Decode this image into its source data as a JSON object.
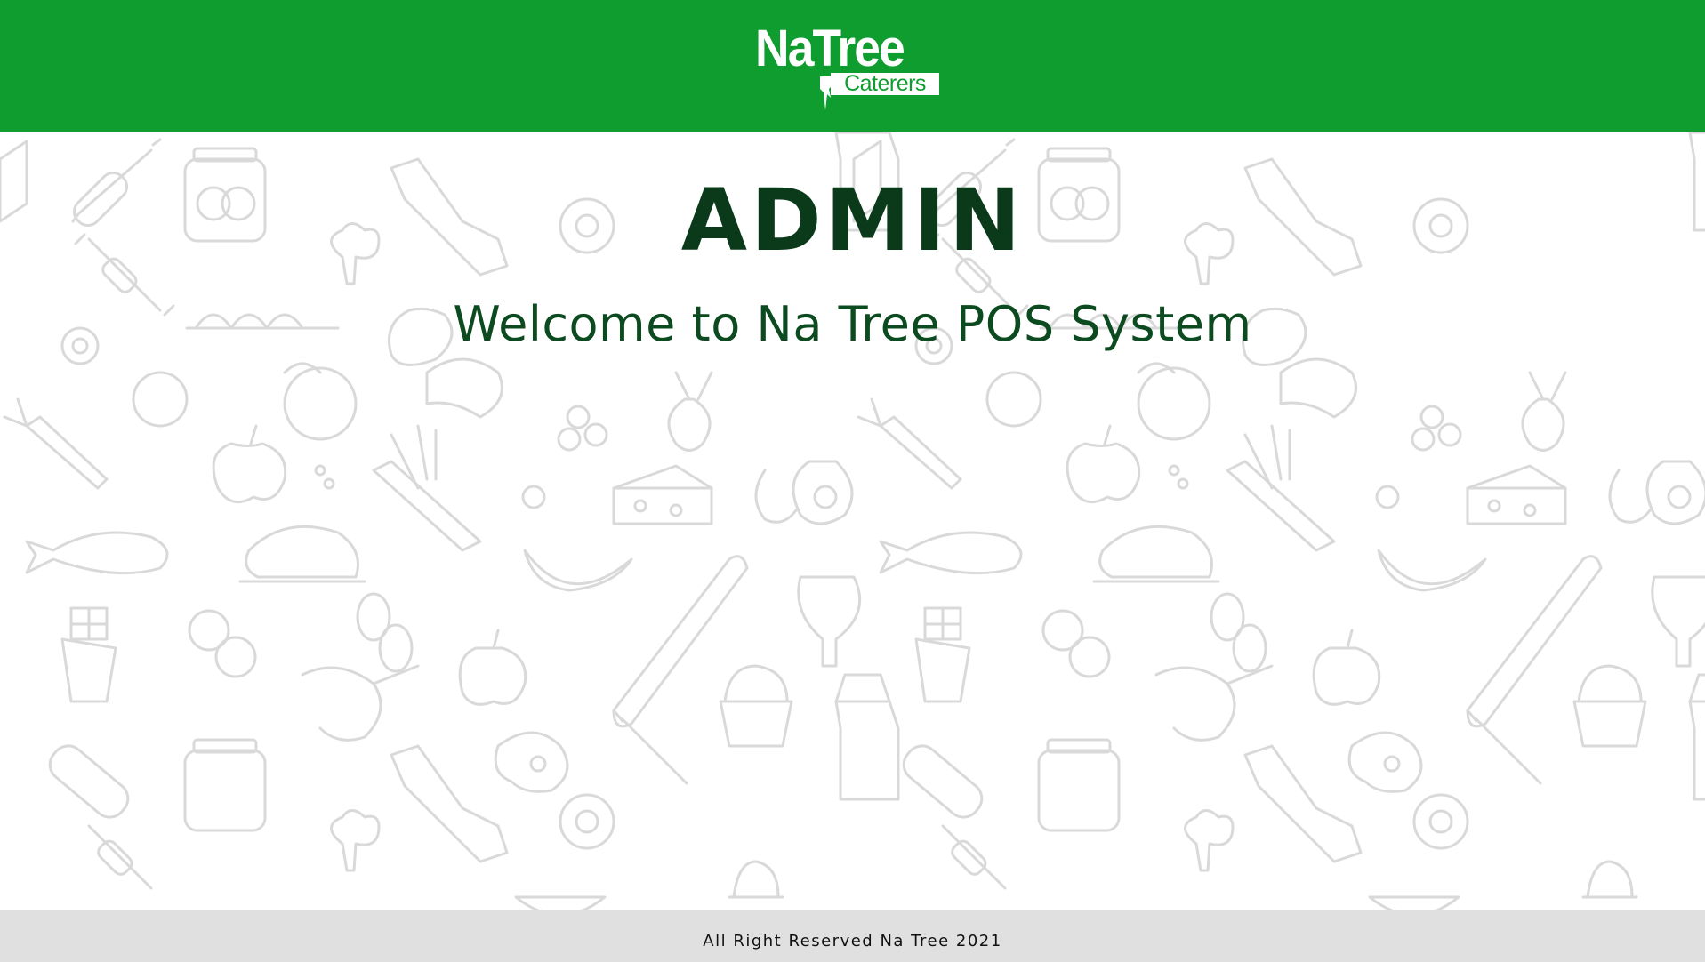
{
  "brand": {
    "name": "NaTree",
    "tagline": "Caterers",
    "header_color": "#0f9d2f"
  },
  "main": {
    "title": "ADMIN",
    "subtitle": "Welcome to Na Tree POS System"
  },
  "background": {
    "pattern": "food-doodle-icons",
    "stroke_color": "#d6d6d6"
  },
  "footer": {
    "text": "All Right Reserved Na Tree 2021"
  }
}
